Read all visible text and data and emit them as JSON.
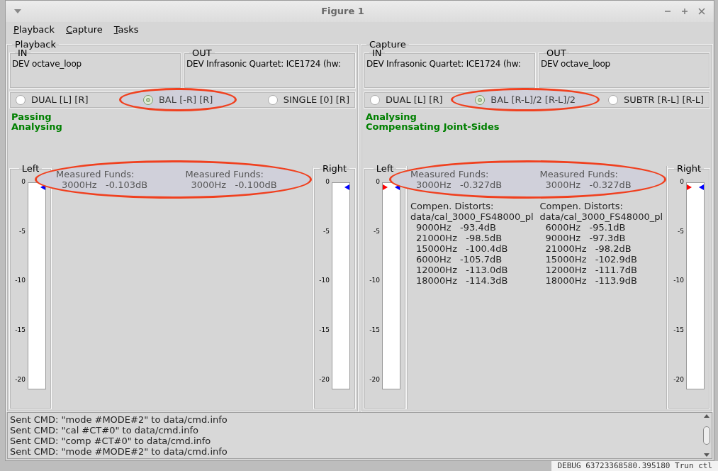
{
  "window": {
    "title": "Figure 1"
  },
  "menu": [
    {
      "label": "Playback"
    },
    {
      "label": "Capture"
    },
    {
      "label": "Tasks"
    }
  ],
  "panels": [
    {
      "title": "Playback",
      "in_label": "IN",
      "in": "DEV octave_loop",
      "out_label": "OUT",
      "out": "DEV Infrasonic Quartet: ICE1724 (hw:",
      "modes": [
        {
          "label": "DUAL [L] [R]",
          "selected": false,
          "circled": false
        },
        {
          "label": "BAL [-R] [R]",
          "selected": true,
          "circled": true
        },
        {
          "label": "SINGLE [0] [R]",
          "selected": false,
          "circled": false
        }
      ],
      "status": [
        "Passing",
        "Analysing"
      ],
      "funds_circled": true,
      "meters": [
        {
          "label": "Left",
          "ticks": [
            "0",
            "-5",
            "-10",
            "-15",
            "-20"
          ],
          "red_marker": false
        },
        {
          "label": "Right",
          "ticks": [
            "0",
            "-5",
            "-10",
            "-15",
            "-20"
          ],
          "red_marker": false
        }
      ],
      "channels": [
        {
          "heading": "Measured Funds:",
          "fund": "3000Hz   -0.103dB"
        },
        {
          "heading": "Measured Funds:",
          "fund": "3000Hz   -0.100dB"
        }
      ]
    },
    {
      "title": "Capture",
      "in_label": "IN",
      "in": "DEV Infrasonic Quartet: ICE1724 (hw:",
      "out_label": "OUT",
      "out": "DEV octave_loop",
      "modes": [
        {
          "label": "DUAL [L] [R]",
          "selected": false,
          "circled": false
        },
        {
          "label": "BAL [R-L]/2 [R-L]/2",
          "selected": true,
          "circled": true
        },
        {
          "label": "SUBTR [R-L] [R-L]",
          "selected": false,
          "circled": false
        }
      ],
      "status": [
        "Analysing",
        "Compensating Joint-Sides"
      ],
      "funds_circled": true,
      "meters": [
        {
          "label": "Left",
          "ticks": [
            "0",
            "-5",
            "-10",
            "-15",
            "-20"
          ],
          "red_marker": true
        },
        {
          "label": "Right",
          "ticks": [
            "0",
            "-5",
            "-10",
            "-15",
            "-20"
          ],
          "red_marker": true
        }
      ],
      "channels": [
        {
          "heading": "Measured Funds:",
          "fund": "3000Hz   -0.327dB",
          "distort_heading": "Compen. Distorts:",
          "distort_file": "data/cal_3000_FS48000_pl",
          "distorts": [
            "9000Hz   -93.4dB",
            "21000Hz   -98.5dB",
            "15000Hz   -100.4dB",
            "6000Hz   -105.7dB",
            "12000Hz   -113.0dB",
            "18000Hz   -114.3dB"
          ]
        },
        {
          "heading": "Measured Funds:",
          "fund": "3000Hz   -0.327dB",
          "distort_heading": "Compen. Distorts:",
          "distort_file": "data/cal_3000_FS48000_pl",
          "distorts": [
            "6000Hz   -95.1dB",
            "9000Hz   -97.3dB",
            "21000Hz   -98.2dB",
            "15000Hz   -102.9dB",
            "12000Hz   -111.7dB",
            "18000Hz   -113.9dB"
          ]
        }
      ]
    }
  ],
  "log": [
    "Sent CMD: \"mode #MODE#2\" to data/cmd.info",
    "Sent CMD: \"cal #CT#0\" to data/cmd.info",
    "Sent CMD: \"comp #CT#0\" to data/cmd.info",
    "Sent CMD: \"mode #MODE#2\" to data/cmd.info"
  ],
  "background_text": "DEBUG 63723368580.395180 Trun ctl"
}
